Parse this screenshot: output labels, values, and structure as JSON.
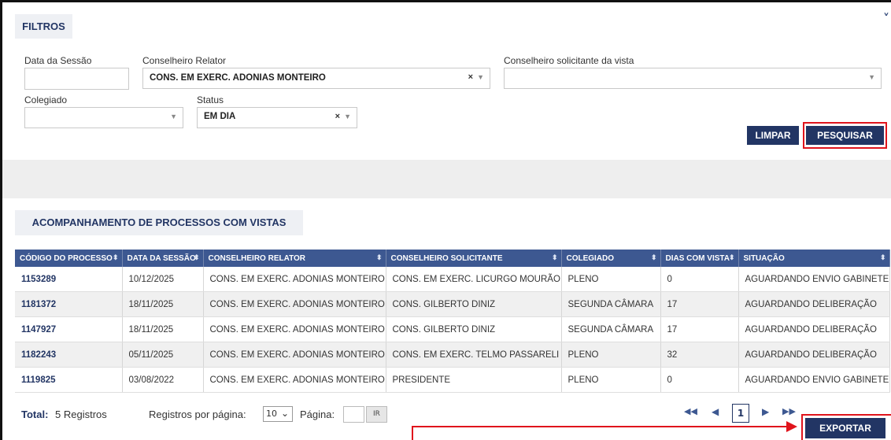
{
  "filters": {
    "title": "FILTROS",
    "data_sessao_label": "Data da Sessão",
    "data_sessao_value": "",
    "conselheiro_relator_label": "Conselheiro Relator",
    "conselheiro_relator_value": "CONS. EM EXERC. ADONIAS MONTEIRO",
    "conselheiro_solicitante_label": "Conselheiro solicitante da vista",
    "conselheiro_solicitante_value": "",
    "colegiado_label": "Colegiado",
    "colegiado_value": "",
    "status_label": "Status",
    "status_value": "EM DIA",
    "clear_symbol": "×",
    "caret_symbol": "▼",
    "limpar_label": "LIMPAR",
    "pesquisar_label": "PESQUISAR"
  },
  "results": {
    "title": "ACOMPANHAMENTO DE PROCESSOS COM VISTAS",
    "sort_symbol": "⬍",
    "columns": [
      "CÓDIGO DO PROCESSO",
      "DATA DA SESSÃO",
      "CONSELHEIRO RELATOR",
      "CONSELHEIRO SOLICITANTE",
      "COLEGIADO",
      "DIAS COM VISTA",
      "SITUAÇÃO"
    ],
    "rows": [
      [
        "1153289",
        "10/12/2025",
        "CONS. EM EXERC. ADONIAS MONTEIRO",
        "CONS. EM EXERC. LICURGO MOURÃO",
        "PLENO",
        "0",
        "AGUARDANDO ENVIO GABINETE"
      ],
      [
        "1181372",
        "18/11/2025",
        "CONS. EM EXERC. ADONIAS MONTEIRO",
        "CONS. GILBERTO DINIZ",
        "SEGUNDA CÂMARA",
        "17",
        "AGUARDANDO DELIBERAÇÃO"
      ],
      [
        "1147927",
        "18/11/2025",
        "CONS. EM EXERC. ADONIAS MONTEIRO",
        "CONS. GILBERTO DINIZ",
        "SEGUNDA CÂMARA",
        "17",
        "AGUARDANDO DELIBERAÇÃO"
      ],
      [
        "1182243",
        "05/11/2025",
        "CONS. EM EXERC. ADONIAS MONTEIRO",
        "CONS. EM EXERC. TELMO PASSARELI",
        "PLENO",
        "32",
        "AGUARDANDO DELIBERAÇÃO"
      ],
      [
        "1119825",
        "03/08/2022",
        "CONS. EM EXERC. ADONIAS MONTEIRO",
        "PRESIDENTE",
        "PLENO",
        "0",
        "AGUARDANDO ENVIO GABINETE"
      ]
    ]
  },
  "footer": {
    "total_label": "Total:",
    "total_value": "5 Registros",
    "per_page_label": "Registros por página:",
    "per_page_value": "10",
    "per_page_caret": "⌄",
    "page_label": "Página:",
    "page_input_value": "",
    "ir_label": "IR",
    "first_symbol": "◀◀",
    "prev_symbol": "◀",
    "current_page": "1",
    "next_symbol": "▶",
    "last_symbol": "▶▶",
    "exportar_label": "EXPORTAR"
  },
  "colors": {
    "primary": "#223564",
    "header": "#3d5891",
    "highlight": "#e0141c"
  }
}
